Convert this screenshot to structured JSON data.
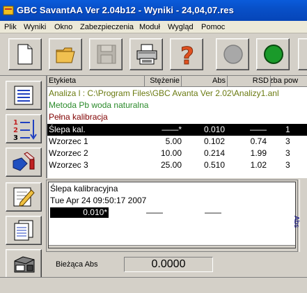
{
  "window": {
    "title": "GBC SavantAA Ver 2.04b12 - Wyniki - 24,04,07.res"
  },
  "menu": [
    "Plik",
    "Wyniki",
    "Okno",
    "Zabezpieczenia",
    "Moduł",
    "Wygląd",
    "Pomoc"
  ],
  "toolbar": {
    "buttons": [
      "new-document",
      "open-folder",
      "save",
      "print",
      "help",
      "stop",
      "run"
    ],
    "run_color": "#1a9a2a",
    "stop_color": "#a8a8a8"
  },
  "results": {
    "columns": [
      "Etykieta",
      "Stężenie",
      "Abs",
      "RSD",
      "Liczba pow"
    ],
    "path_line": "Analiza l : C:\\Program Files\\GBC Avanta Ver 2.02\\Analizy1.anl",
    "method_line": "Metoda Pb woda naturalna",
    "calibration_line": "Pełna kalibracja",
    "rows": [
      {
        "label": "Ślepa kal.",
        "conc": "——*",
        "abs": "0.010",
        "rsd": "——",
        "reps": "1"
      },
      {
        "label": "Wzorzec 1",
        "conc": "5.00",
        "abs": "0.102",
        "rsd": "0.74",
        "reps": "3"
      },
      {
        "label": "Wzorzec 2",
        "conc": "10.00",
        "abs": "0.214",
        "rsd": "1.99",
        "reps": "3"
      },
      {
        "label": "Wzorzec 3",
        "conc": "25.00",
        "abs": "0.510",
        "rsd": "1.02",
        "reps": "3"
      }
    ]
  },
  "detail": {
    "title": "Ślepa kalibracyjna",
    "timestamp": "Tue Apr 24 09:50:17 2007",
    "value": "0.010*",
    "dash1": "——",
    "dash2": "——"
  },
  "right_tab": "Abs",
  "current_abs": {
    "label": "Bieżąca Abs",
    "value": "0.0000"
  }
}
